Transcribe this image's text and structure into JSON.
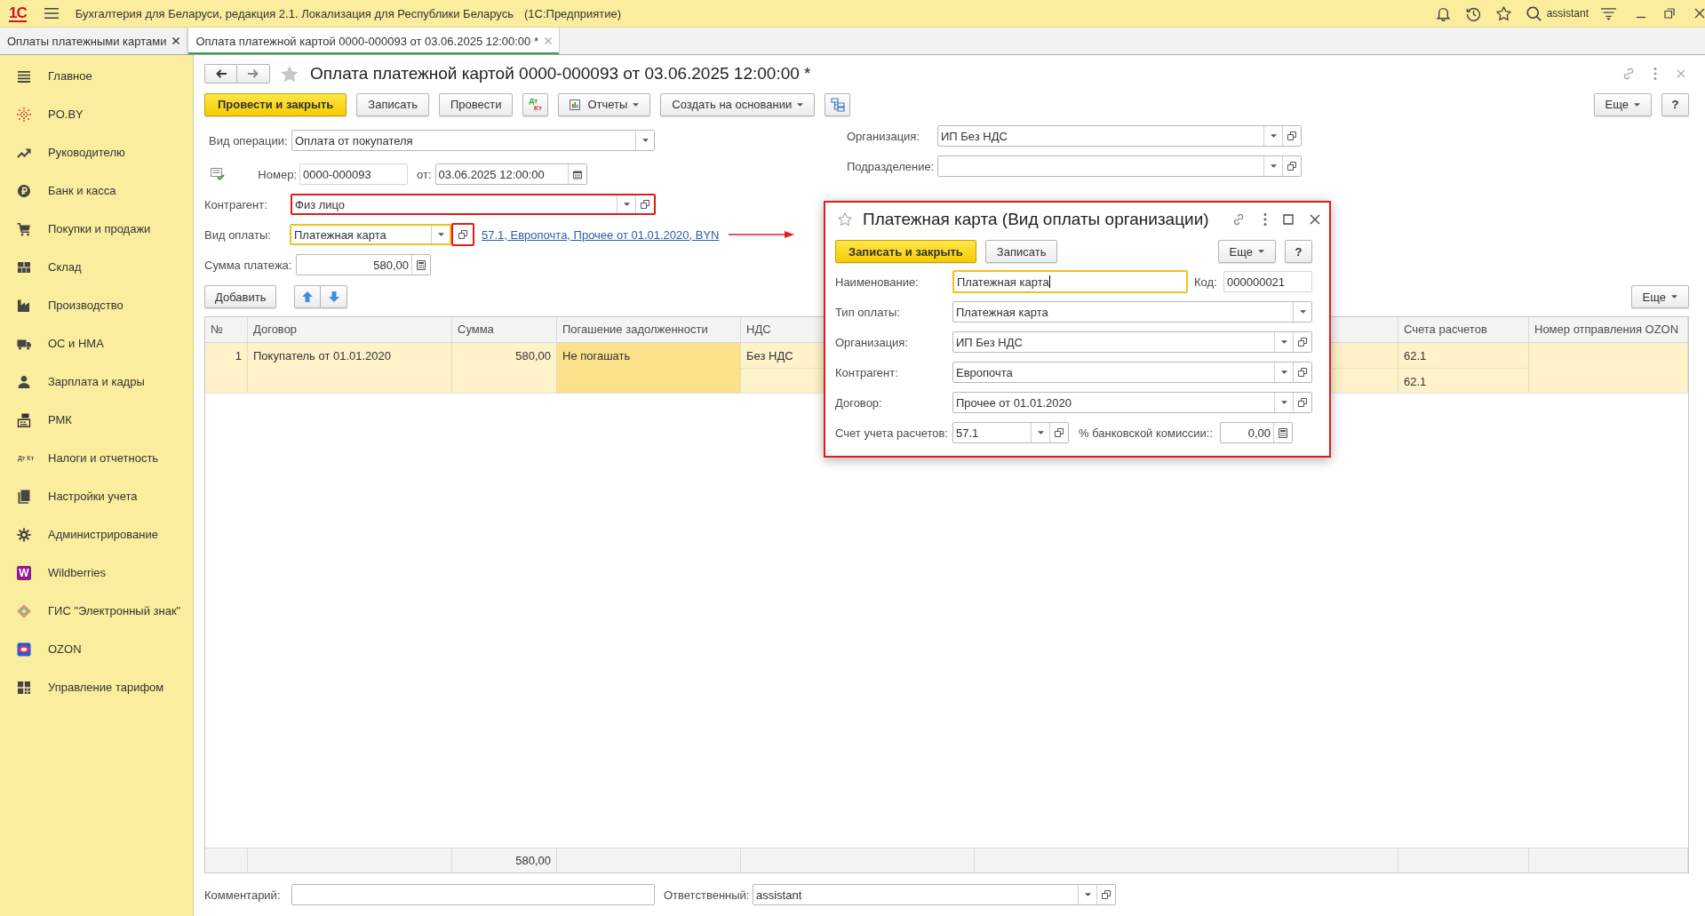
{
  "app_bar": {
    "logo": "1С",
    "title": "Бухгалтерия для Беларуси, редакция 2.1. Локализация для Республики Беларусь",
    "platform": "(1С:Предприятие)",
    "user": "assistant"
  },
  "tabs": [
    {
      "label": "Оплаты платежными картами",
      "selected": false
    },
    {
      "label": "Оплата платежной картой 0000-000093 от 03.06.2025 12:00:00 *",
      "selected": true
    }
  ],
  "sidebar": {
    "items": [
      {
        "label": "Главное"
      },
      {
        "label": "PO.BY"
      },
      {
        "label": "Руководителю"
      },
      {
        "label": "Банк и касса"
      },
      {
        "label": "Покупки и продажи"
      },
      {
        "label": "Склад"
      },
      {
        "label": "Производство"
      },
      {
        "label": "ОС и НМА"
      },
      {
        "label": "Зарплата и кадры"
      },
      {
        "label": "РМК"
      },
      {
        "label": "Налоги и отчетность",
        "icon_text": "Дт Кт"
      },
      {
        "label": "Настройки учета"
      },
      {
        "label": "Администрирование"
      },
      {
        "label": "Wildberries",
        "icon_text": "W"
      },
      {
        "label": "ГИС \"Электронный знак\""
      },
      {
        "label": "OZON"
      },
      {
        "label": "Управление тарифом"
      }
    ]
  },
  "document": {
    "title": "Оплата платежной картой 0000-000093 от 03.06.2025 12:00:00 *",
    "toolbar": [
      {
        "kind": "primary",
        "label": "Провести и закрыть"
      },
      {
        "kind": "plain",
        "label": "Записать"
      },
      {
        "kind": "plain",
        "label": "Провести"
      },
      {
        "kind": "debit_credit",
        "top": "Дт",
        "bottom": "Кт"
      },
      {
        "kind": "report",
        "label": "Отчеты"
      },
      {
        "kind": "menu",
        "label": "Создать на основании"
      },
      {
        "kind": "structure"
      }
    ],
    "more_button": "Еще",
    "help_button": "?",
    "operation_type": {
      "label": "Вид операции:",
      "value": "Оплата от покупателя"
    },
    "number": {
      "label": "Номер:",
      "value": "0000-000093"
    },
    "date": {
      "label": "от:",
      "value": "03.06.2025 12:00:00"
    },
    "counterparty": {
      "label": "Контрагент:",
      "value": "Физ лицо",
      "highlighted": true
    },
    "payment_kind": {
      "label": "Вид оплаты:",
      "value": "Платежная карта",
      "focused": true,
      "open_highlighted": true,
      "link": "57.1, Европочта, Прочее от 01.01.2020, BYN"
    },
    "amount": {
      "label": "Сумма платежа:",
      "value": "580,00"
    },
    "organization": {
      "label": "Организация:",
      "value": "ИП Без НДС"
    },
    "subdivision": {
      "label": "Подразделение:"
    },
    "table_toolbar": {
      "add_button": "Добавить",
      "more_button": "Еще"
    },
    "table": {
      "columns": [
        "№",
        "Договор",
        "Сумма",
        "Погашение задолженности",
        "НДС",
        "Счета расчетов",
        "Номер отправления OZON"
      ],
      "rows": [
        {
          "selected": true,
          "cells": [
            {
              "lines": [
                "1"
              ],
              "selected": false
            },
            {
              "lines": [
                "Покупатель от 01.01.2020"
              ],
              "selected": false
            },
            {
              "lines": [
                "580,00"
              ],
              "selected": false
            },
            {
              "lines": [
                "Не погашать"
              ],
              "selected": true
            },
            {
              "lines": [
                "Без НДС"
              ],
              "selected": false
            },
            {
              "lines": [
                "62.1",
                "62.1"
              ],
              "selected": false
            }
          ]
        }
      ],
      "total_amount": "580,00"
    },
    "comment": {
      "label": "Комментарий:"
    },
    "responsible": {
      "label": "Ответственный:",
      "value": "assistant"
    }
  },
  "dialog": {
    "title": "Платежная карта (Вид оплаты организации)",
    "highlighted": true,
    "buttons": [
      {
        "kind": "primary",
        "label": "Записать и закрыть"
      },
      {
        "kind": "plain",
        "label": "Записать"
      }
    ],
    "more_button": "Еще",
    "help_button": "?",
    "name": {
      "label": "Наименование:",
      "value": "Платежная карта",
      "focused": true
    },
    "code": {
      "label": "Код:",
      "value": "000000021"
    },
    "fields": [
      {
        "kind": "select",
        "label": "Тип оплаты:",
        "value": "Платежная карта"
      },
      {
        "kind": "reference",
        "label": "Организация:",
        "value": "ИП Без НДС"
      },
      {
        "kind": "reference",
        "label": "Контрагент:",
        "value": "Европочта"
      },
      {
        "kind": "reference",
        "label": "Договор:",
        "value": "Прочее от 01.01.2020"
      }
    ],
    "account": {
      "label": "Счет учета расчетов:",
      "value": "57.1"
    },
    "commission": {
      "label": "% банковской комиссии::",
      "value": "0,00"
    }
  }
}
